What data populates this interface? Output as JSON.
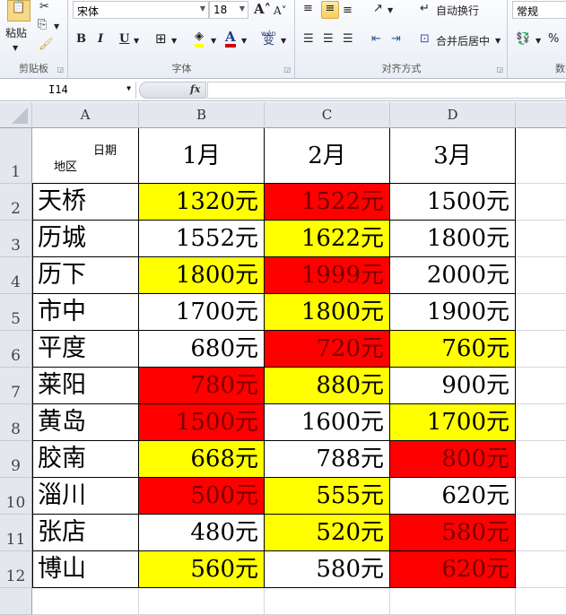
{
  "ribbon": {
    "clipboard": {
      "label": "剪贴板",
      "paste": "粘贴"
    },
    "font": {
      "label": "字体",
      "font_name": "宋体",
      "font_size": "18",
      "bold": "B",
      "italic": "I",
      "underline": "U",
      "phonetic": "wén"
    },
    "alignment": {
      "label": "对齐方式",
      "wrap_text": "自动换行",
      "merge_center": "合并后居中"
    },
    "number": {
      "label": "数字",
      "format": "常规",
      "percent": "%"
    }
  },
  "formula_bar": {
    "name_box": "I14",
    "fx": "fx",
    "formula": ""
  },
  "colors": {
    "yellow": "#ffff00",
    "red": "#ff0000",
    "red_text": "#7a0000"
  },
  "sheet": {
    "columns": [
      "A",
      "B",
      "C",
      "D"
    ],
    "row_numbers": [
      "1",
      "2",
      "3",
      "4",
      "5",
      "6",
      "7",
      "8",
      "9",
      "10",
      "11",
      "12"
    ],
    "header": {
      "corner_top": "日期",
      "corner_bottom": "地区",
      "months": [
        "1月",
        "2月",
        "3月"
      ]
    },
    "rows": [
      {
        "region": "天桥",
        "values": [
          "1320元",
          "1522元",
          "1500元"
        ],
        "fills": [
          "yellow",
          "red",
          "none"
        ]
      },
      {
        "region": "历城",
        "values": [
          "1552元",
          "1622元",
          "1800元"
        ],
        "fills": [
          "none",
          "yellow",
          "none"
        ]
      },
      {
        "region": "历下",
        "values": [
          "1800元",
          "1999元",
          "2000元"
        ],
        "fills": [
          "yellow",
          "red",
          "none"
        ]
      },
      {
        "region": "市中",
        "values": [
          "1700元",
          "1800元",
          "1900元"
        ],
        "fills": [
          "none",
          "yellow",
          "none"
        ]
      },
      {
        "region": "平度",
        "values": [
          "680元",
          "720元",
          "760元"
        ],
        "fills": [
          "none",
          "red",
          "yellow"
        ]
      },
      {
        "region": "莱阳",
        "values": [
          "780元",
          "880元",
          "900元"
        ],
        "fills": [
          "red",
          "yellow",
          "none"
        ]
      },
      {
        "region": "黄岛",
        "values": [
          "1500元",
          "1600元",
          "1700元"
        ],
        "fills": [
          "red",
          "none",
          "yellow"
        ]
      },
      {
        "region": "胶南",
        "values": [
          "668元",
          "788元",
          "800元"
        ],
        "fills": [
          "yellow",
          "none",
          "red"
        ]
      },
      {
        "region": "淄川",
        "values": [
          "500元",
          "555元",
          "620元"
        ],
        "fills": [
          "red",
          "yellow",
          "none"
        ]
      },
      {
        "region": "张店",
        "values": [
          "480元",
          "520元",
          "580元"
        ],
        "fills": [
          "none",
          "yellow",
          "red"
        ]
      },
      {
        "region": "博山",
        "values": [
          "560元",
          "580元",
          "620元"
        ],
        "fills": [
          "yellow",
          "none",
          "red"
        ]
      }
    ]
  }
}
